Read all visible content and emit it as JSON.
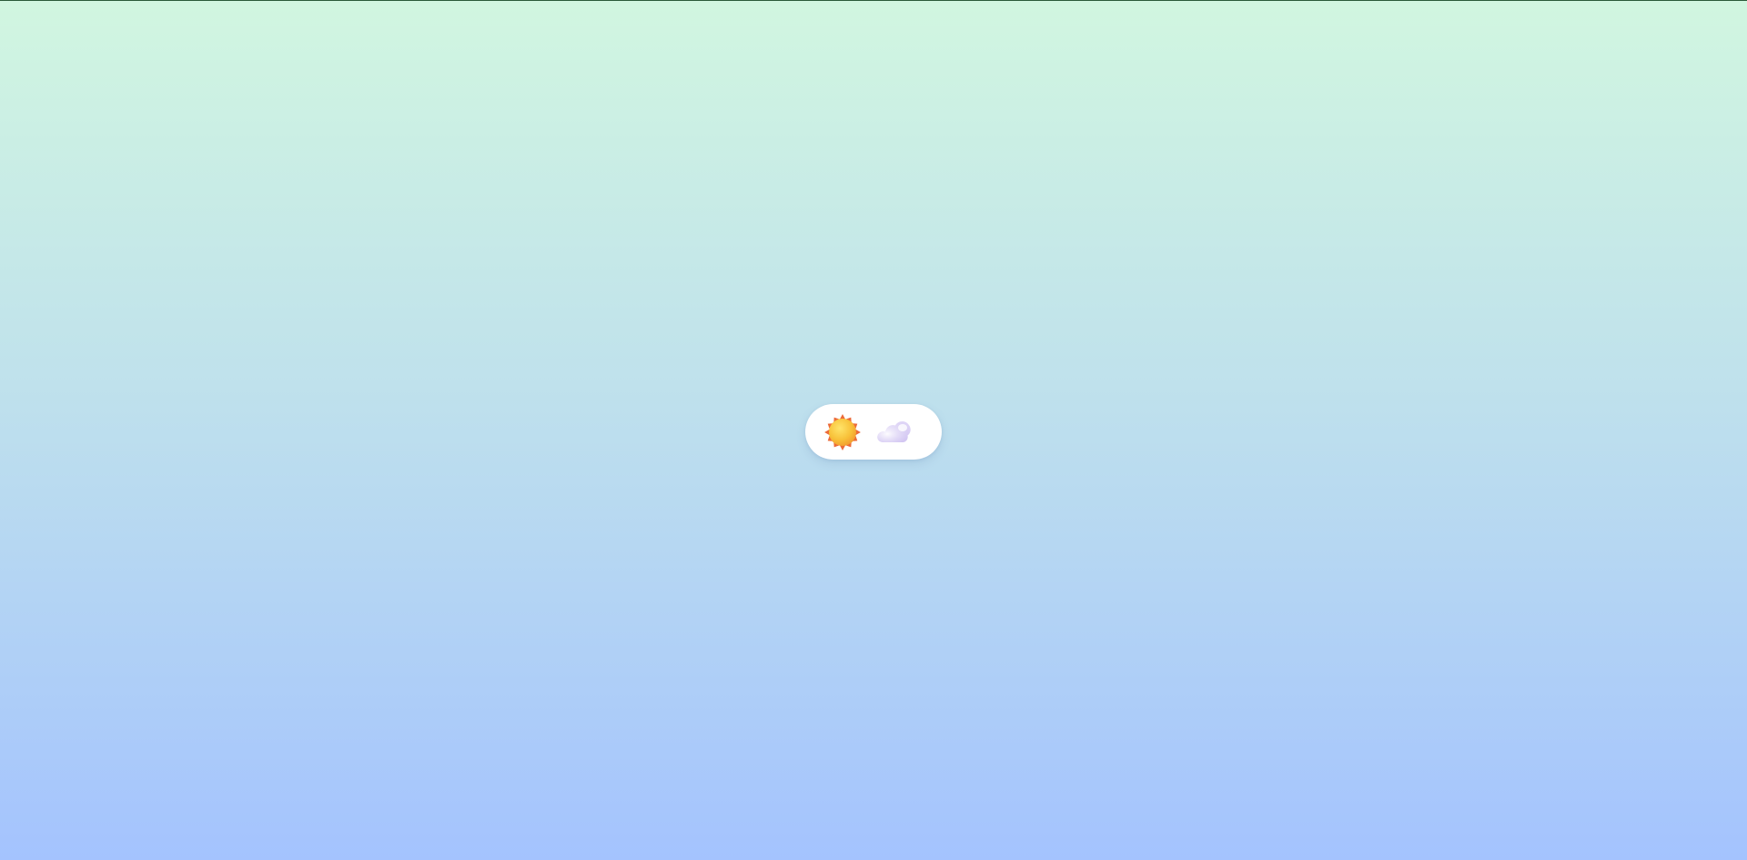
{
  "theme_toggle": {
    "selected": "sun",
    "options": [
      {
        "icon": "sun-icon",
        "selected": true
      },
      {
        "icon": "cloud-icon",
        "selected": false
      }
    ]
  },
  "colors": {
    "background_top": "#d1f6e0",
    "background_bottom": "#a4c3fe",
    "toggle_background": "#ffffff",
    "sun": "#f7c63d",
    "sun_rays": "#ec6b39",
    "cloud": "#e6e0fb"
  }
}
